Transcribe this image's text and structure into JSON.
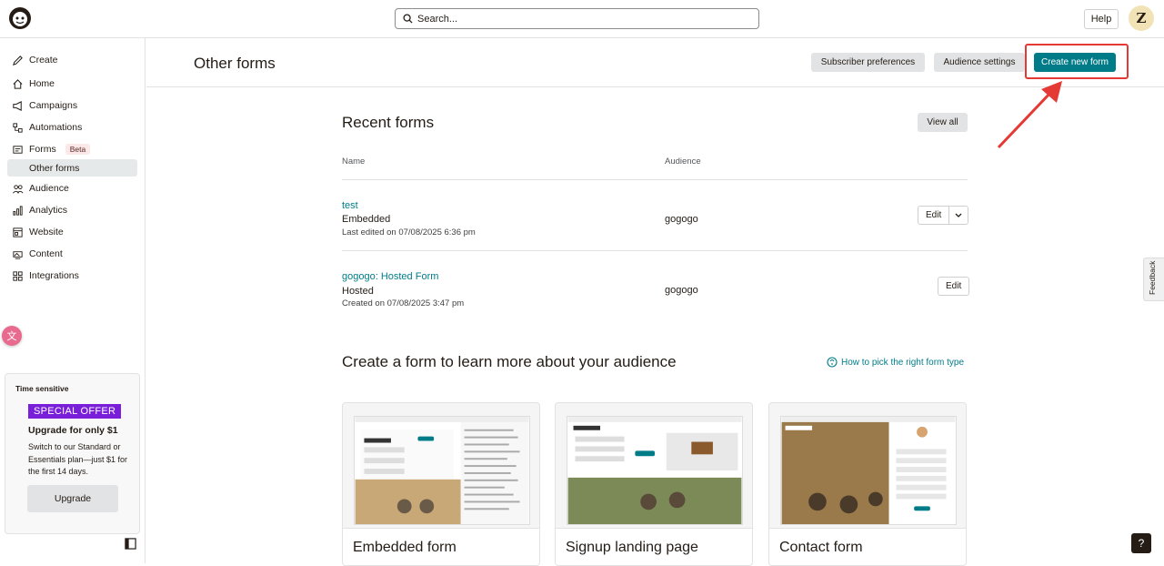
{
  "topbar": {
    "search_placeholder": "Search...",
    "help_label": "Help",
    "avatar_initial": "Z"
  },
  "sidebar": {
    "items": [
      {
        "label": "Create",
        "icon": "pencil-icon"
      },
      {
        "label": "Home",
        "icon": "home-icon"
      },
      {
        "label": "Campaigns",
        "icon": "megaphone-icon"
      },
      {
        "label": "Automations",
        "icon": "automation-icon"
      },
      {
        "label": "Forms",
        "icon": "form-icon",
        "badge": "Beta"
      },
      {
        "label": "Audience",
        "icon": "audience-icon"
      },
      {
        "label": "Analytics",
        "icon": "chart-icon"
      },
      {
        "label": "Website",
        "icon": "website-icon"
      },
      {
        "label": "Content",
        "icon": "content-icon"
      },
      {
        "label": "Integrations",
        "icon": "grid-icon"
      }
    ],
    "subitem": "Other forms",
    "offer": {
      "time_label": "Time sensitive",
      "badge": "SPECIAL OFFER",
      "title": "Upgrade for only $1",
      "text": "Switch to our Standard or Essentials plan—just $1 for the first 14 days.",
      "button": "Upgrade"
    }
  },
  "header": {
    "title": "Other forms",
    "subscriber_prefs": "Subscriber preferences",
    "audience_settings": "Audience settings",
    "create_new_form": "Create new form"
  },
  "recent": {
    "title": "Recent forms",
    "view_all": "View all",
    "col_name": "Name",
    "col_audience": "Audience",
    "rows": [
      {
        "name": "test",
        "type": "Embedded",
        "date": "Last edited on 07/08/2025 6:36 pm",
        "audience": "gogogo",
        "edit": "Edit"
      },
      {
        "name": "gogogo: Hosted Form",
        "type": "Hosted",
        "date": "Created on 07/08/2025 3:47 pm",
        "audience": "gogogo",
        "edit": "Edit"
      }
    ]
  },
  "create_section": {
    "title": "Create a form to learn more about your audience",
    "help_link": "How to pick the right form type",
    "cards": [
      {
        "label": "Embedded form"
      },
      {
        "label": "Signup landing page"
      },
      {
        "label": "Contact form"
      }
    ]
  },
  "misc": {
    "feedback": "Feedback",
    "question": "?"
  },
  "colors": {
    "primary": "#007c89",
    "annotation": "#e53935",
    "offer": "#7a1fd9"
  }
}
